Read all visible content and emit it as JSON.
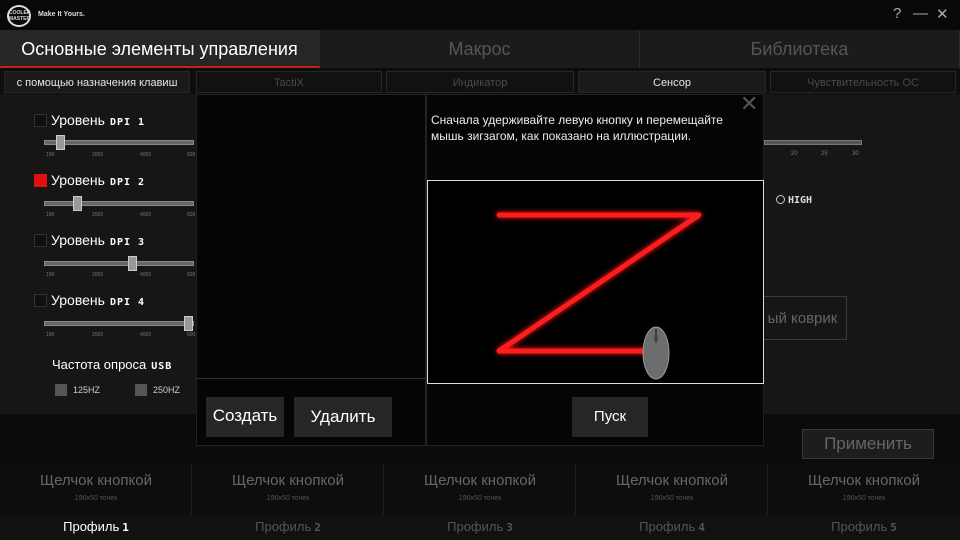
{
  "window": {
    "logo_text": "COOLER MASTER",
    "tagline": "Make It Yours.",
    "help_icon": "?",
    "minimize_icon": "—",
    "close_icon": "✕"
  },
  "main_tabs": [
    {
      "label": "Основные элементы управления",
      "active": true
    },
    {
      "label": "Макрос",
      "active": false
    },
    {
      "label": "Библиотека",
      "active": false
    }
  ],
  "sub_tabs": [
    {
      "label": "с помощью назначения клавиш",
      "active": true
    },
    {
      "label": "TactiX",
      "active": false
    },
    {
      "label": "Индикатор",
      "active": false
    },
    {
      "label": "Сенсор",
      "active": true
    },
    {
      "label": "Чувствительность ОС",
      "active": false
    }
  ],
  "dpi_levels": [
    {
      "label": "Уровень",
      "tag": "DPI 1",
      "checked": false,
      "value_fraction": 0.08
    },
    {
      "label": "Уровень",
      "tag": "DPI 2",
      "checked": true,
      "value_fraction": 0.2
    },
    {
      "label": "Уровень",
      "tag": "DPI 3",
      "checked": false,
      "value_fraction": 0.6
    },
    {
      "label": "Уровень",
      "tag": "DPI 4",
      "checked": false,
      "value_fraction": 1.0
    }
  ],
  "slider_ticks": [
    "100",
    "2000",
    "4000",
    "600"
  ],
  "polling": {
    "label": "Частота опроса",
    "tag": "USB",
    "options": [
      "125HZ",
      "250HZ"
    ]
  },
  "right_panel": {
    "ticks": [
      "20",
      "25",
      "30"
    ],
    "high_label": "HIGH",
    "mat_button": "ый коврик",
    "apply_button": "Применить"
  },
  "modal": {
    "create_button": "Создать",
    "delete_button": "Удалить",
    "instructions": "Сначала удерживайте левую кнопку и перемещайте мышь зигзагом, как показано на иллюстрации.",
    "start_button": "Пуск",
    "close_icon": "✕"
  },
  "profiles": [
    {
      "button": "Щелчок кнопкой",
      "size": "190x50 точек",
      "name": "Профиль",
      "num": "1",
      "active": true
    },
    {
      "button": "Щелчок кнопкой",
      "size": "190x50 точек",
      "name": "Профиль",
      "num": "2",
      "active": false
    },
    {
      "button": "Щелчок кнопкой",
      "size": "190x50 точек",
      "name": "Профиль",
      "num": "3",
      "active": false
    },
    {
      "button": "Щелчок кнопкой",
      "size": "190x50 точек",
      "name": "Профиль",
      "num": "4",
      "active": false
    },
    {
      "button": "Щелчок кнопкой",
      "size": "190x50 точек",
      "name": "Профиль",
      "num": "5",
      "active": false
    }
  ]
}
